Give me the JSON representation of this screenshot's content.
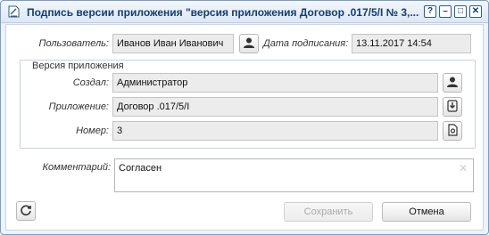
{
  "window": {
    "title": "Подпись версии приложения \"версия приложения Договор .017/5/I № 3,...",
    "controls": {
      "help": "?",
      "minimize": "–",
      "maximize": "□",
      "close": "✕"
    }
  },
  "user": {
    "label": "Пользователь:",
    "value": "Иванов Иван Иванович"
  },
  "sign_date": {
    "label": "Дата подписания:",
    "value": "13.11.2017 14:54"
  },
  "version_group": {
    "legend": "Версия приложения",
    "created_by": {
      "label": "Создал:",
      "value": "Администратор"
    },
    "attachment": {
      "label": "Приложение:",
      "value": "Договор .017/5/I"
    },
    "number": {
      "label": "Номер:",
      "value": "3"
    }
  },
  "comment": {
    "label": "Комментарий:",
    "value": "Согласен"
  },
  "footer": {
    "save_label": "Сохранить",
    "cancel_label": "Отмена"
  },
  "icons": {
    "title": "document-sign-icon",
    "user": "user-icon",
    "download": "download-icon",
    "open": "open-document-icon",
    "refresh": "refresh-icon",
    "clear": "clear-icon"
  },
  "colors": {
    "title_text": "#153d6d",
    "window_border": "#7a9cc4",
    "field_bg": "#ececec"
  }
}
